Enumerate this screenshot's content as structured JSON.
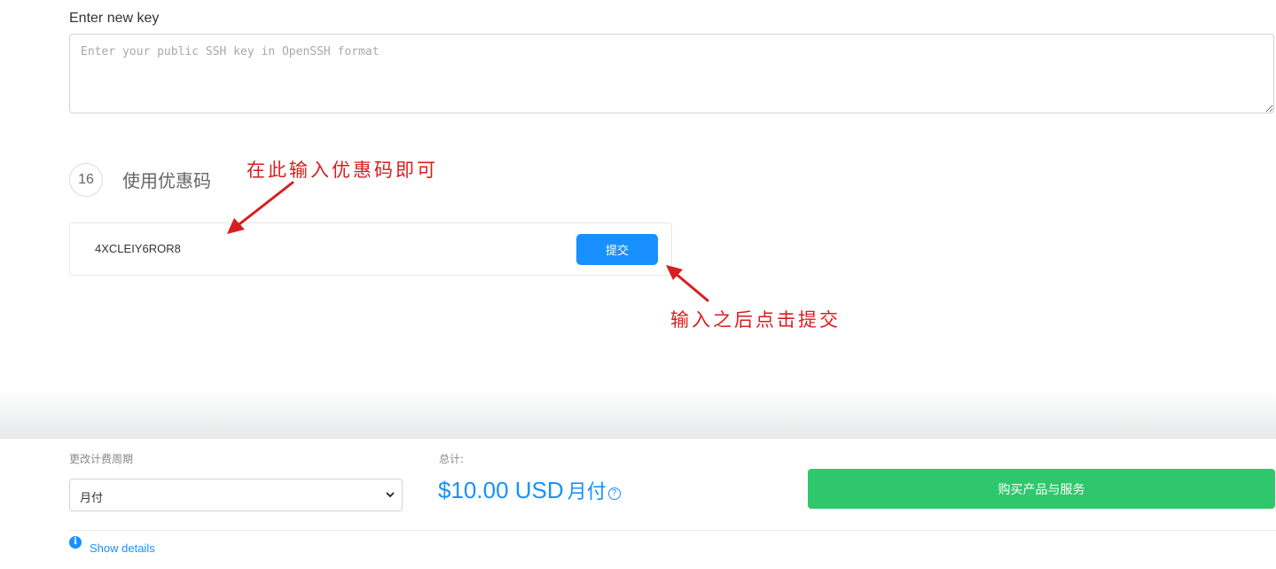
{
  "ssh_key": {
    "label": "Enter new key",
    "placeholder": "Enter your public SSH key in OpenSSH format",
    "value": ""
  },
  "promo": {
    "step_number": "16",
    "title": "使用优惠码",
    "code": "4XCLEIY6ROR8",
    "submit_label": "提交"
  },
  "annotations": {
    "enter_here": "在此输入优惠码即可",
    "click_submit": "输入之后点击提交",
    "color": "#d81e1e"
  },
  "footer": {
    "cycle_label": "更改计费周期",
    "cycle_value": "月付",
    "total_label": "总计:",
    "total_amount": "$10.00 USD",
    "total_cycle": "月付",
    "help_icon": "question-circle-icon",
    "buy_label": "购买产品与服务",
    "details_icon": "info-circle-icon",
    "details_label": "Show details"
  },
  "colors": {
    "accent": "#1890ff",
    "buy": "#2ec76b"
  }
}
